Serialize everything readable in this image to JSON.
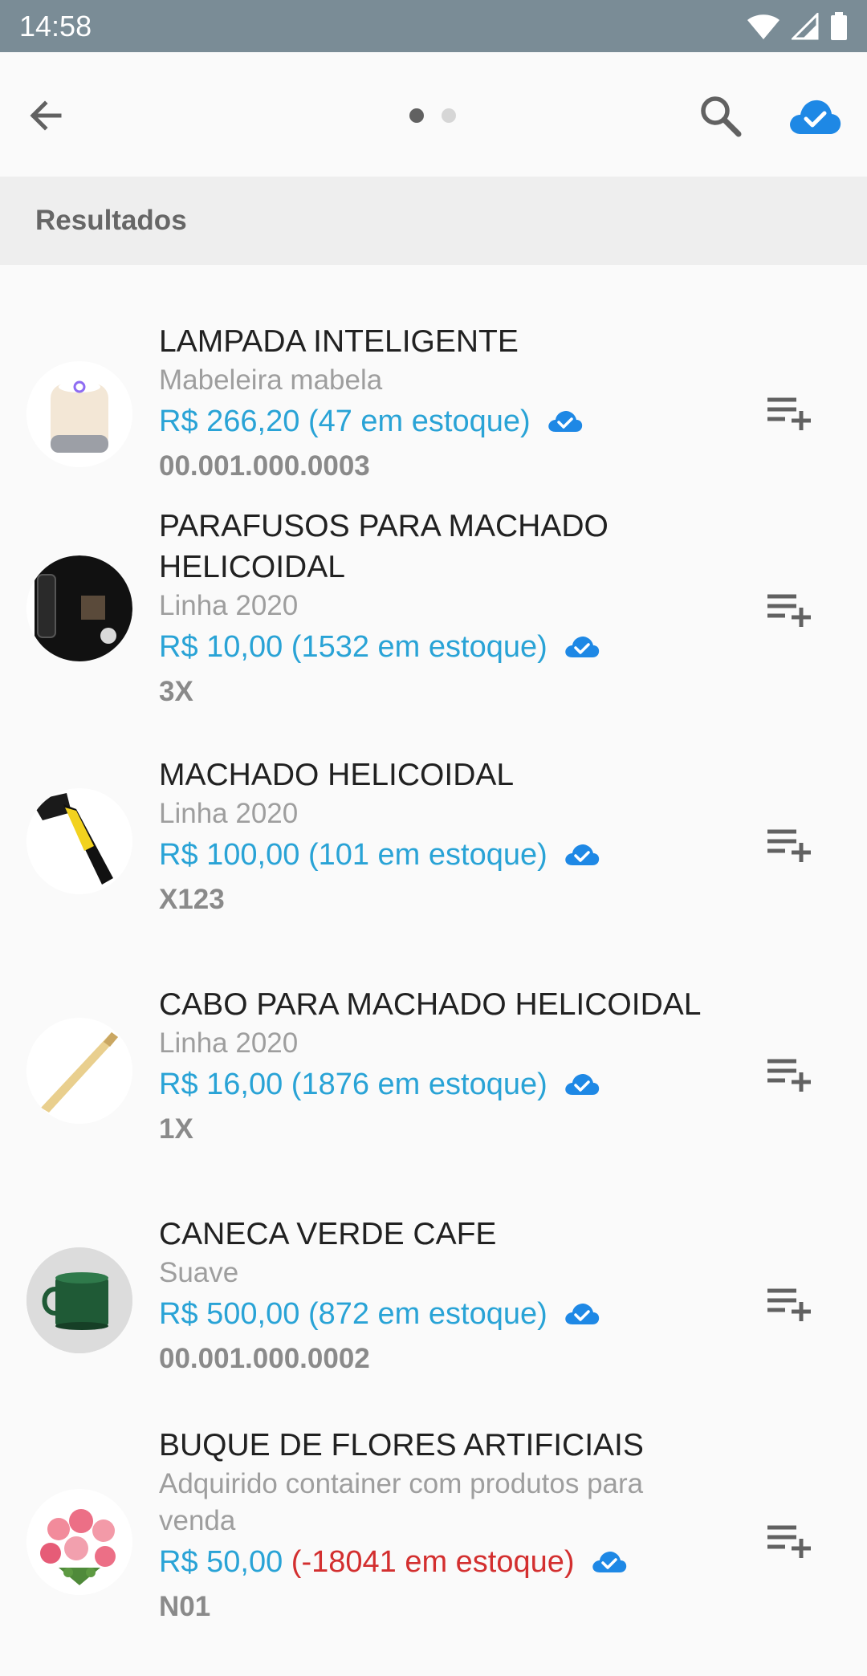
{
  "status": {
    "time": "14:58"
  },
  "colors": {
    "accent": "#29a3d6",
    "cloud": "#1e88e5",
    "negative": "#d32f2f",
    "status_bar": "#7a8c96"
  },
  "app_bar": {
    "pager": {
      "pages": 2,
      "current": 1
    },
    "icons": [
      "back-arrow-icon",
      "search-icon",
      "cloud-check-icon"
    ]
  },
  "section": {
    "title": "Resultados"
  },
  "products": [
    {
      "name": "LAMPADA INTELIGENTE",
      "sub": "Mabeleira mabela",
      "price": "R$ 266,20",
      "stock": "(47 em estoque)",
      "code": "00.001.000.0003",
      "thumb": "lamp"
    },
    {
      "name": "PARAFUSOS PARA MACHADO HELICOIDAL",
      "sub": "Linha 2020",
      "price": "R$ 10,00",
      "stock": "(1532 em estoque)",
      "code": "3X",
      "thumb": "screws"
    },
    {
      "name": "MACHADO HELICOIDAL",
      "sub": "Linha 2020",
      "price": "R$ 100,00",
      "stock": "(101 em estoque)",
      "code": "X123",
      "thumb": "axe"
    },
    {
      "name": "CABO PARA MACHADO HELICOIDAL",
      "sub": "Linha 2020",
      "price": "R$ 16,00",
      "stock": "(1876 em estoque)",
      "code": "1X",
      "thumb": "handle"
    },
    {
      "name": "CANECA VERDE CAFE",
      "sub": "Suave",
      "price": "R$ 500,00",
      "stock": "(872 em estoque)",
      "code": "00.001.000.0002",
      "thumb": "mug"
    },
    {
      "name": "BUQUE DE FLORES ARTIFICIAIS",
      "sub": "Adquirido container com produtos para venda",
      "price": "R$ 50,00",
      "stock": "(-18041 em estoque)",
      "code": "N01",
      "thumb": "flowers"
    }
  ]
}
